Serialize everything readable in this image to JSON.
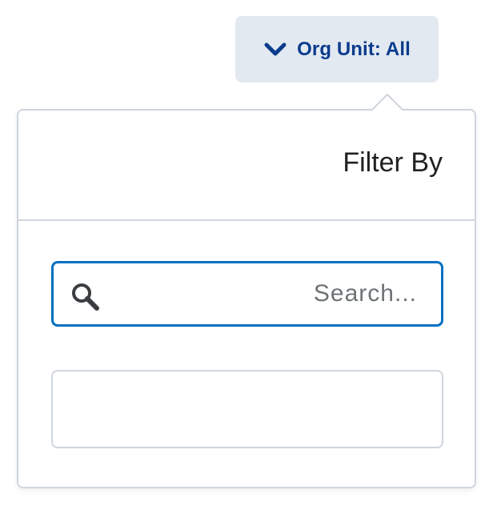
{
  "filter_button": {
    "label": "Org Unit: All",
    "icon": "chevron-down-icon",
    "color": "#0a3c8c",
    "background": "#e3e9f1"
  },
  "dropdown": {
    "title": "Filter By",
    "search": {
      "placeholder": "...Search",
      "value": "",
      "icon": "search-icon",
      "border_color": "#0070c0"
    },
    "options": []
  }
}
